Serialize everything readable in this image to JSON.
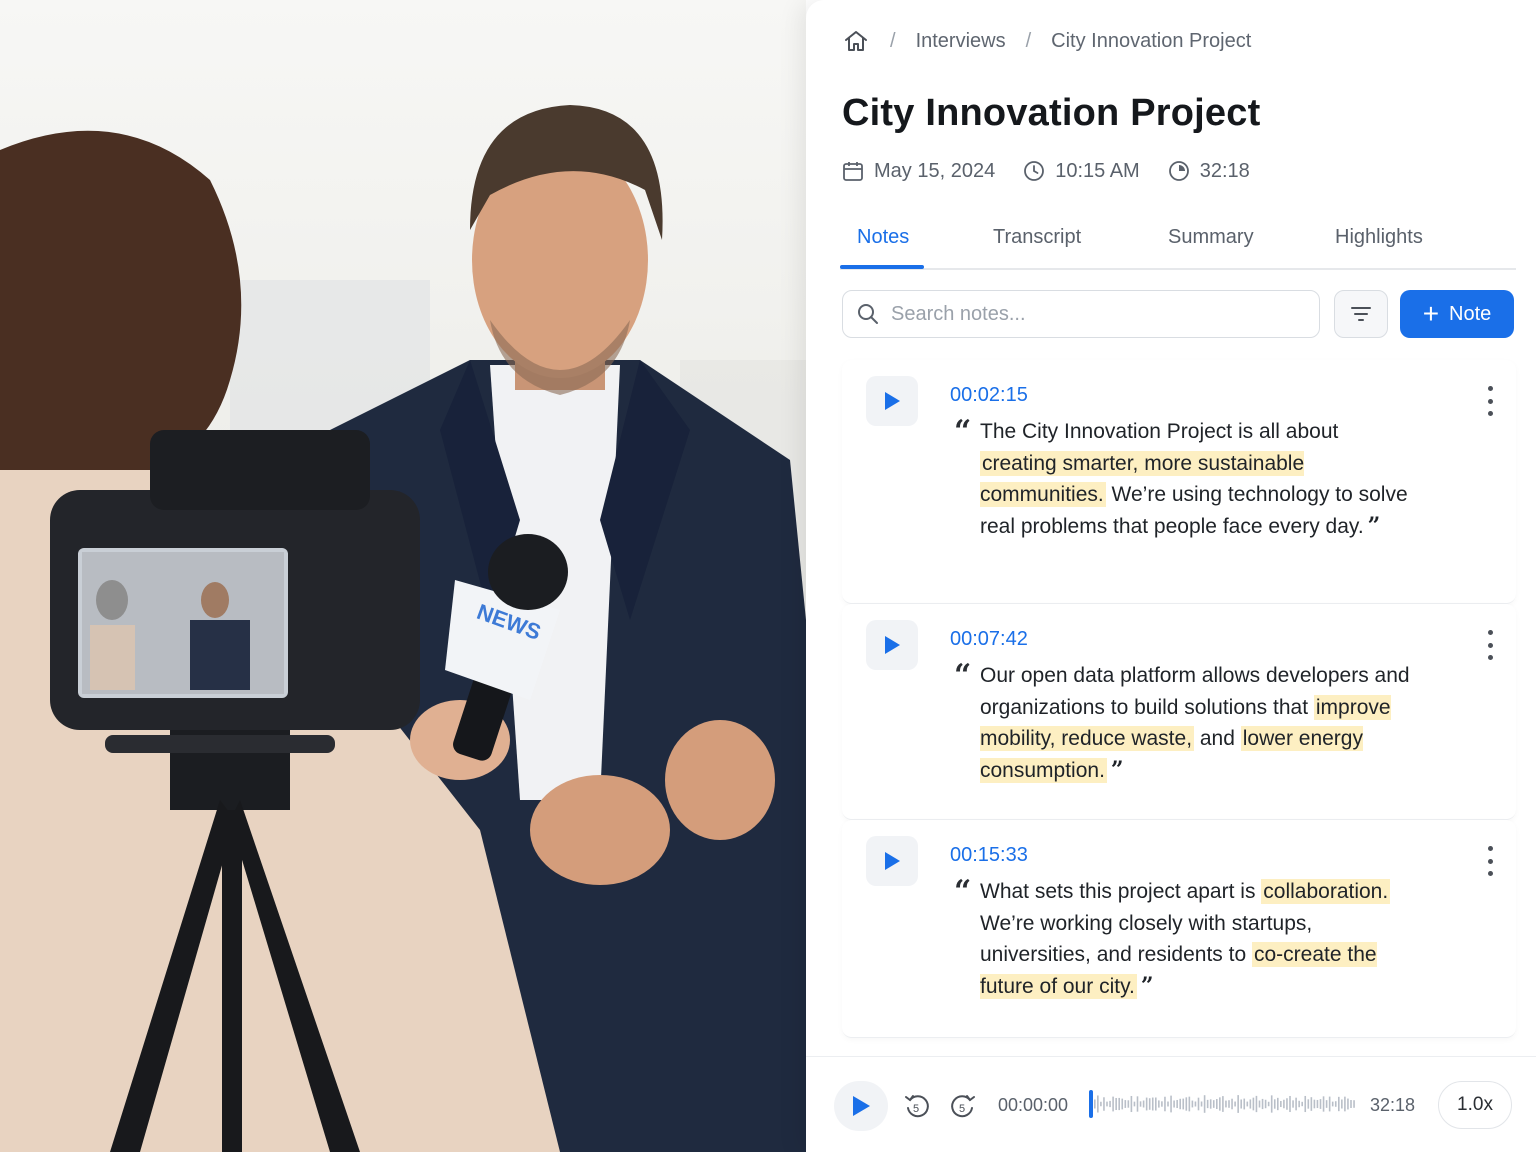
{
  "breadcrumb": {
    "home_icon": "home-icon",
    "separator": "/",
    "items": [
      "Interviews",
      "City Innovation Project"
    ]
  },
  "title": "City Innovation Project",
  "meta": {
    "date": "May 15, 2024",
    "time": "10:15 AM",
    "duration": "32:18"
  },
  "tabs": [
    "Notes",
    "Transcript",
    "Summary",
    "Highlights"
  ],
  "active_tab": "Notes",
  "search": {
    "placeholder": "Search notes..."
  },
  "add_note_label": "Note",
  "notes": [
    {
      "timestamp": "00:02:15",
      "segments": [
        {
          "text": "The City Innovation Project is all about ",
          "highlight": false
        },
        {
          "text": "creating smarter, more sustainable communities.",
          "highlight": true
        },
        {
          "text": " We’re using technology to solve real problems that people face every day.",
          "highlight": false
        }
      ]
    },
    {
      "timestamp": "00:07:42",
      "segments": [
        {
          "text": "Our open data platform allows developers and organizations to build solutions that ",
          "highlight": false
        },
        {
          "text": "improve mobility, reduce waste,",
          "highlight": true
        },
        {
          "text": " and ",
          "highlight": false
        },
        {
          "text": "lower energy consumption.",
          "highlight": true
        }
      ]
    },
    {
      "timestamp": "00:15:33",
      "segments": [
        {
          "text": "What sets this project apart is ",
          "highlight": false
        },
        {
          "text": "collaboration.",
          "highlight": true
        },
        {
          "text": " We’re working closely with startups, universities, and residents to ",
          "highlight": false
        },
        {
          "text": "co-create the future of our city.",
          "highlight": true
        }
      ]
    }
  ],
  "player": {
    "current_time": "00:00:00",
    "total_time": "32:18",
    "speed": "1.0x",
    "progress": 0,
    "rewind_label": "5",
    "forward_label": "5"
  },
  "photo": {
    "mic_flag_text": "NEWS"
  },
  "colors": {
    "accent": "#1a6fe8",
    "highlight": "#fdefc2"
  }
}
